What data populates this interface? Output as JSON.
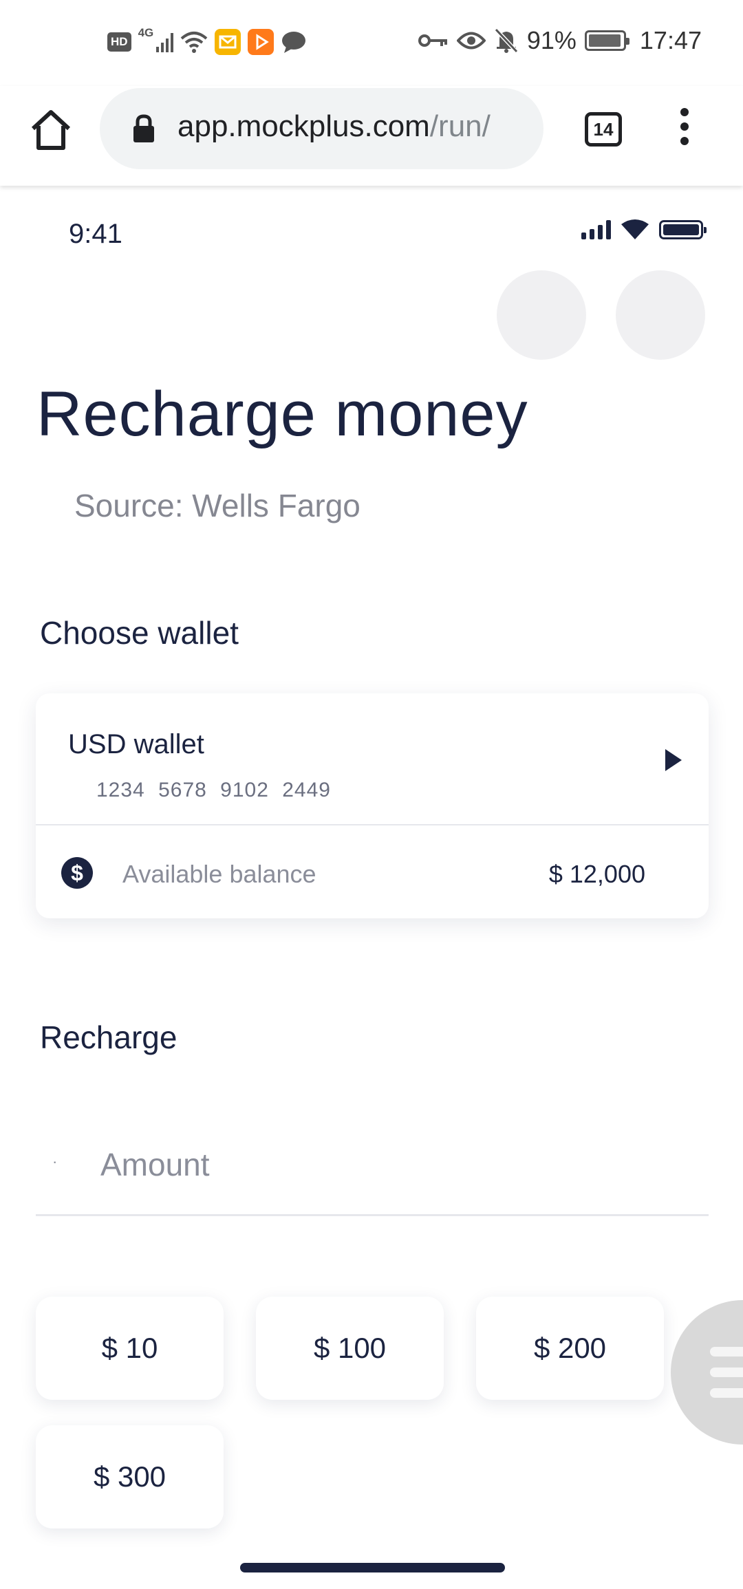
{
  "system_status": {
    "hd_label": "HD",
    "network_label": "4G",
    "battery_percent": "91%",
    "time": "17:47"
  },
  "browser": {
    "url_domain": "app.mockplus.com",
    "url_path": "/run/",
    "tab_count": "14"
  },
  "app_status": {
    "time": "9:41"
  },
  "page": {
    "title": "Recharge money",
    "source": "Source: Wells Fargo"
  },
  "wallet_section": {
    "label": "Choose wallet",
    "wallet_name": "USD wallet",
    "card_number": "1234 5678 9102 2449",
    "balance_label": "Available balance",
    "balance_value": "$ 12,000",
    "currency_symbol": "$"
  },
  "recharge_section": {
    "label": "Recharge",
    "amount_placeholder": "Amount",
    "amount_prefix": "·",
    "presets": [
      "$ 10",
      "$ 100",
      "$ 200",
      "$ 300"
    ]
  },
  "colors": {
    "primary": "#1b2340",
    "muted": "#8a8d99",
    "circle_bg": "#f0f0f2",
    "fab_bg": "#d9d9d9"
  }
}
